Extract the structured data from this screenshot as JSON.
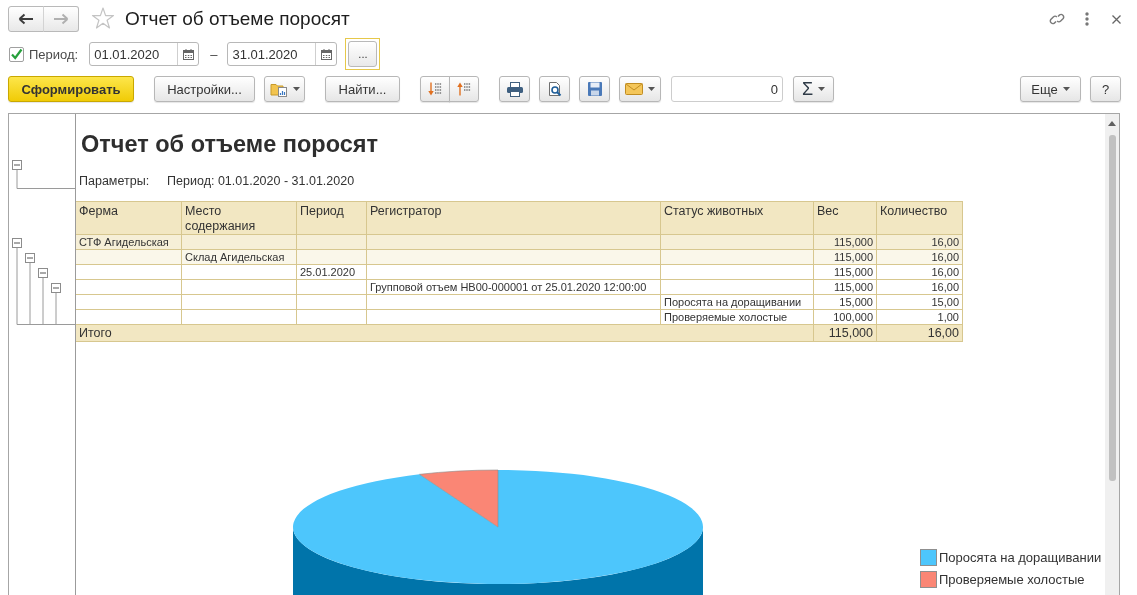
{
  "window": {
    "title": "Отчет об отъеме поросят",
    "favorite": false
  },
  "navigation": {
    "back_enabled": true,
    "forward_enabled": false
  },
  "period": {
    "enabled": true,
    "label": "Период:",
    "from": "01.01.2020",
    "separator": "–",
    "to": "31.01.2020",
    "choose_button": {
      "label": "...",
      "focused": true
    }
  },
  "toolbar": {
    "generate": "Сформировать",
    "settings": "Настройки...",
    "find": "Найти...",
    "sum_value": "0",
    "sum_button": "Σ",
    "more": "Еще",
    "help": "?"
  },
  "report": {
    "title": "Отчет об отъеме поросят",
    "header_expanded": true,
    "parameters_label": "Параметры:",
    "parameters_value": "Период: 01.01.2020 - 31.01.2020",
    "columns": [
      "Ферма",
      "Место содержания",
      "Период",
      "Регистратор",
      "Статус животных",
      "Вес",
      "Количество"
    ],
    "rows": [
      {
        "label": "СТФ Агидельская",
        "weight": "115,000",
        "quantity": "16,00",
        "expanded": true,
        "children": [
          {
            "label": "Склад Агидельская",
            "weight": "115,000",
            "quantity": "16,00",
            "expanded": true,
            "children": [
              {
                "label": "25.01.2020",
                "weight": "115,000",
                "quantity": "16,00",
                "expanded": true,
                "children": [
                  {
                    "label": "Групповой отъем НВ00-000001 от 25.01.2020 12:00:00",
                    "weight": "115,000",
                    "quantity": "16,00",
                    "expanded": true,
                    "children": [
                      {
                        "label": "Поросята на доращивании",
                        "weight": "15,000",
                        "quantity": "15,00"
                      },
                      {
                        "label": "Проверяемые холостые",
                        "weight": "100,000",
                        "quantity": "1,00"
                      }
                    ]
                  }
                ]
              }
            ]
          }
        ]
      }
    ],
    "total": {
      "label": "Итого",
      "weight": "115,000",
      "quantity": "16,00"
    },
    "chart": {
      "legend": [
        {
          "label": "Поросята на доращивании",
          "color": "#4dc6fc"
        },
        {
          "label": "Проверяемые холостые",
          "color": "#fa8675"
        }
      ]
    }
  }
}
